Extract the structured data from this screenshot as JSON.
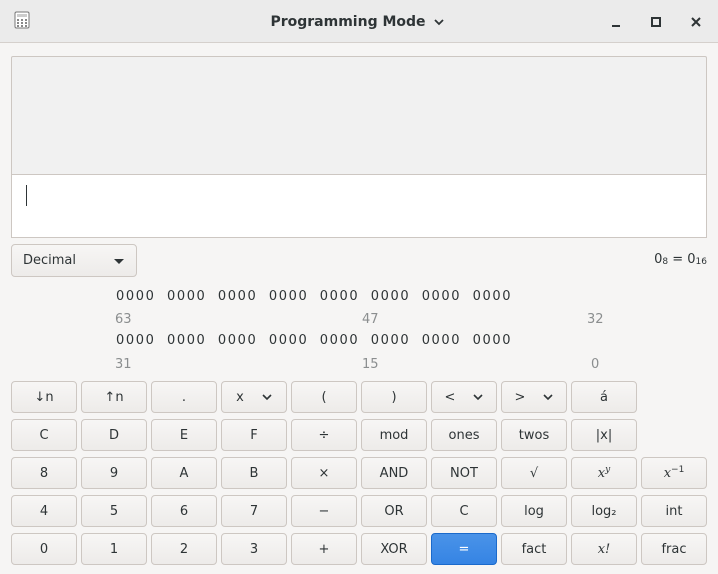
{
  "window": {
    "title": "Programming Mode",
    "icons": {
      "app": "calculator-icon",
      "title_menu": "chevron-down-icon",
      "minimize": "minimize-icon",
      "maximize": "maximize-icon",
      "close": "close-icon"
    }
  },
  "display": {
    "history": "",
    "entry": ""
  },
  "base": {
    "selected": "Decimal"
  },
  "conversion": {
    "octal_value": "0",
    "octal_base": "8",
    "eq": " = ",
    "hex_value": "0",
    "hex_base": "16"
  },
  "bits": {
    "row1": "0000  0000  0000  0000  0000  0000  0000  0000",
    "row2": "0000  0000  0000  0000  0000  0000  0000  0000",
    "labels1": [
      "63",
      "47",
      "32"
    ],
    "labels2": [
      "31",
      "15",
      "0"
    ]
  },
  "keypad": {
    "row1": [
      "↓n",
      "↑n",
      ".",
      "x",
      "(",
      ")",
      "<",
      ">",
      "á"
    ],
    "row2": [
      "C",
      "D",
      "E",
      "F",
      "÷",
      "mod",
      "ones",
      "twos",
      "|x|"
    ],
    "row3": [
      "8",
      "9",
      "A",
      "B",
      "×",
      "AND",
      "NOT",
      "√",
      "x",
      "y",
      "x",
      "−1"
    ],
    "row4": [
      "4",
      "5",
      "6",
      "7",
      "−",
      "OR",
      "C",
      "log",
      "log₂",
      "int"
    ],
    "row5": [
      "0",
      "1",
      "2",
      "3",
      "+",
      "XOR",
      "=",
      "fact",
      "x!",
      "frac"
    ]
  },
  "colors": {
    "accent": "#3584e4"
  }
}
